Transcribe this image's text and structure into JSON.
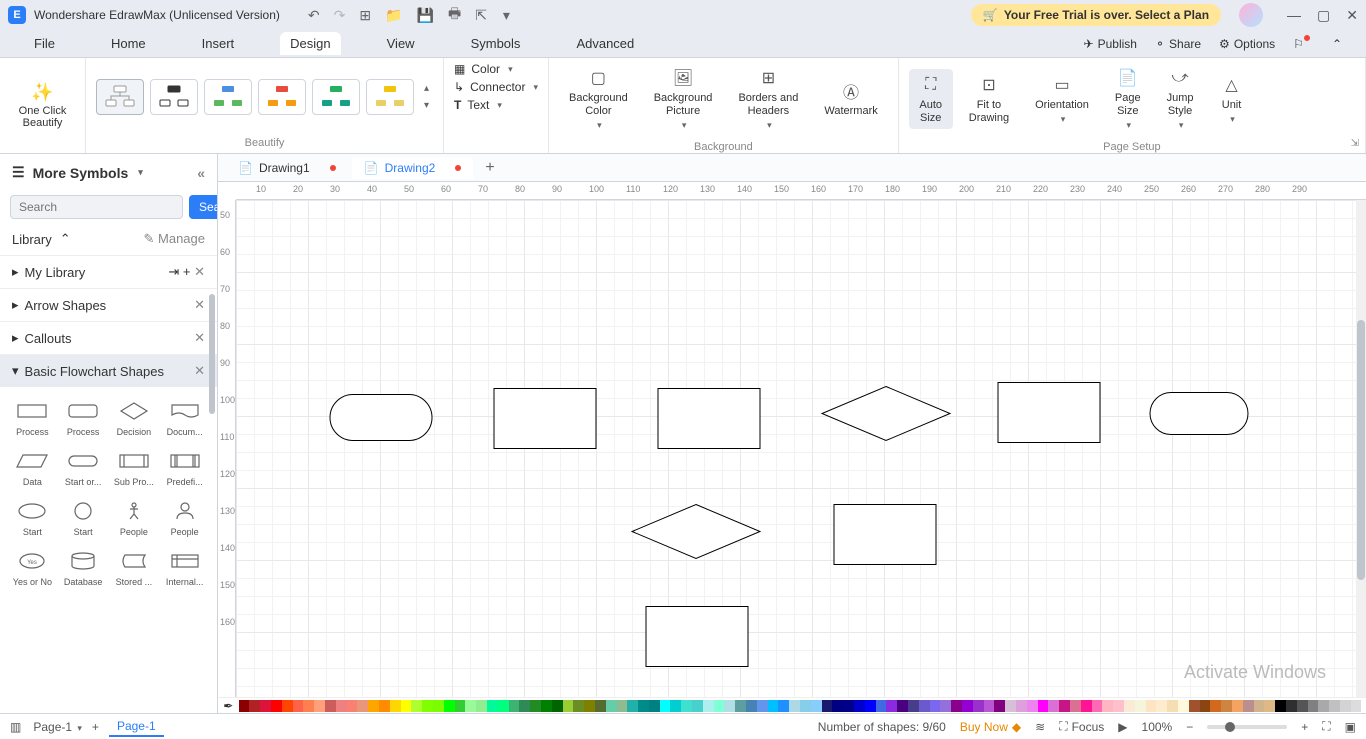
{
  "app": {
    "title": "Wondershare EdrawMax (Unlicensed Version)",
    "logo_letter": "E"
  },
  "trial": {
    "text": "Your Free Trial is over. Select a Plan"
  },
  "menu": {
    "items": [
      "File",
      "Home",
      "Insert",
      "Design",
      "View",
      "Symbols",
      "Advanced"
    ],
    "active": "Design",
    "right": {
      "publish": "Publish",
      "share": "Share",
      "options": "Options"
    }
  },
  "ribbon": {
    "beautify": {
      "one_click": "One Click\nBeautify",
      "group_label": "Beautify"
    },
    "mid": {
      "color": "Color",
      "connector": "Connector",
      "text": "Text"
    },
    "bg_group": {
      "bg_color": "Background\nColor",
      "bg_picture": "Background\nPicture",
      "borders": "Borders and\nHeaders",
      "watermark": "Watermark",
      "label": "Background"
    },
    "page_group": {
      "auto_size": "Auto\nSize",
      "fit": "Fit to\nDrawing",
      "orientation": "Orientation",
      "page_size": "Page\nSize",
      "jump_style": "Jump\nStyle",
      "unit": "Unit",
      "label": "Page Setup"
    }
  },
  "sidebar": {
    "title": "More Symbols",
    "search_placeholder": "Search",
    "search_btn": "Search",
    "library": "Library",
    "manage": "Manage",
    "sections": {
      "my_library": "My Library",
      "arrow_shapes": "Arrow Shapes",
      "callouts": "Callouts",
      "basic_flowchart": "Basic Flowchart Shapes"
    },
    "shapes": [
      "Process",
      "Process",
      "Decision",
      "Docum...",
      "Data",
      "Start or...",
      "Sub Pro...",
      "Predefi...",
      "Start",
      "Start",
      "People",
      "People",
      "Yes or No",
      "Database",
      "Stored ...",
      "Internal..."
    ]
  },
  "docs": {
    "tab1": "Drawing1",
    "tab2": "Drawing2"
  },
  "ruler_h": [
    "10",
    "20",
    "30",
    "40",
    "50",
    "60",
    "70",
    "80",
    "90",
    "100",
    "110",
    "120",
    "130",
    "140",
    "150",
    "160",
    "170",
    "180",
    "190",
    "200",
    "210",
    "220",
    "230",
    "240",
    "250",
    "260",
    "270",
    "280",
    "290"
  ],
  "ruler_v": [
    "50",
    "60",
    "70",
    "80",
    "90",
    "100",
    "110",
    "120",
    "130",
    "140",
    "150",
    "160"
  ],
  "status": {
    "page_select": "Page-1",
    "page_tab": "Page-1",
    "shapes_count": "Number of shapes: 9/60",
    "buy_now": "Buy Now",
    "focus": "Focus",
    "zoom": "100%"
  },
  "watermark_text": "Activate Windows",
  "colors": [
    "#8b0000",
    "#b22222",
    "#dc143c",
    "#ff0000",
    "#ff4500",
    "#ff6347",
    "#ff7f50",
    "#ffa07a",
    "#cd5c5c",
    "#f08080",
    "#fa8072",
    "#e9967a",
    "#ffa500",
    "#ff8c00",
    "#ffd700",
    "#ffff00",
    "#adff2f",
    "#7fff00",
    "#7cfc00",
    "#00ff00",
    "#32cd32",
    "#98fb98",
    "#90ee90",
    "#00fa9a",
    "#00ff7f",
    "#3cb371",
    "#2e8b57",
    "#228b22",
    "#008000",
    "#006400",
    "#9acd32",
    "#6b8e23",
    "#808000",
    "#556b2f",
    "#66cdaa",
    "#8fbc8f",
    "#20b2aa",
    "#008b8b",
    "#008080",
    "#00ffff",
    "#00ced1",
    "#40e0d0",
    "#48d1cc",
    "#afeeee",
    "#7fffd4",
    "#b0e0e6",
    "#5f9ea0",
    "#4682b4",
    "#6495ed",
    "#00bfff",
    "#1e90ff",
    "#add8e6",
    "#87ceeb",
    "#87cefa",
    "#191970",
    "#000080",
    "#00008b",
    "#0000cd",
    "#0000ff",
    "#4169e1",
    "#8a2be2",
    "#4b0082",
    "#483d8b",
    "#6a5acd",
    "#7b68ee",
    "#9370db",
    "#8b008b",
    "#9400d3",
    "#9932cc",
    "#ba55d3",
    "#800080",
    "#d8bfd8",
    "#dda0dd",
    "#ee82ee",
    "#ff00ff",
    "#da70d6",
    "#c71585",
    "#db7093",
    "#ff1493",
    "#ff69b4",
    "#ffb6c1",
    "#ffc0cb",
    "#faebd7",
    "#f5f5dc",
    "#ffe4c4",
    "#ffebcd",
    "#f5deb3",
    "#fff8dc",
    "#a0522d",
    "#8b4513",
    "#d2691e",
    "#cd853f",
    "#f4a460",
    "#bc8f8f",
    "#d2b48c",
    "#deb887",
    "#000000",
    "#2f2f2f",
    "#555555",
    "#808080",
    "#a9a9a9",
    "#c0c0c0",
    "#d3d3d3",
    "#dcdcdc"
  ]
}
